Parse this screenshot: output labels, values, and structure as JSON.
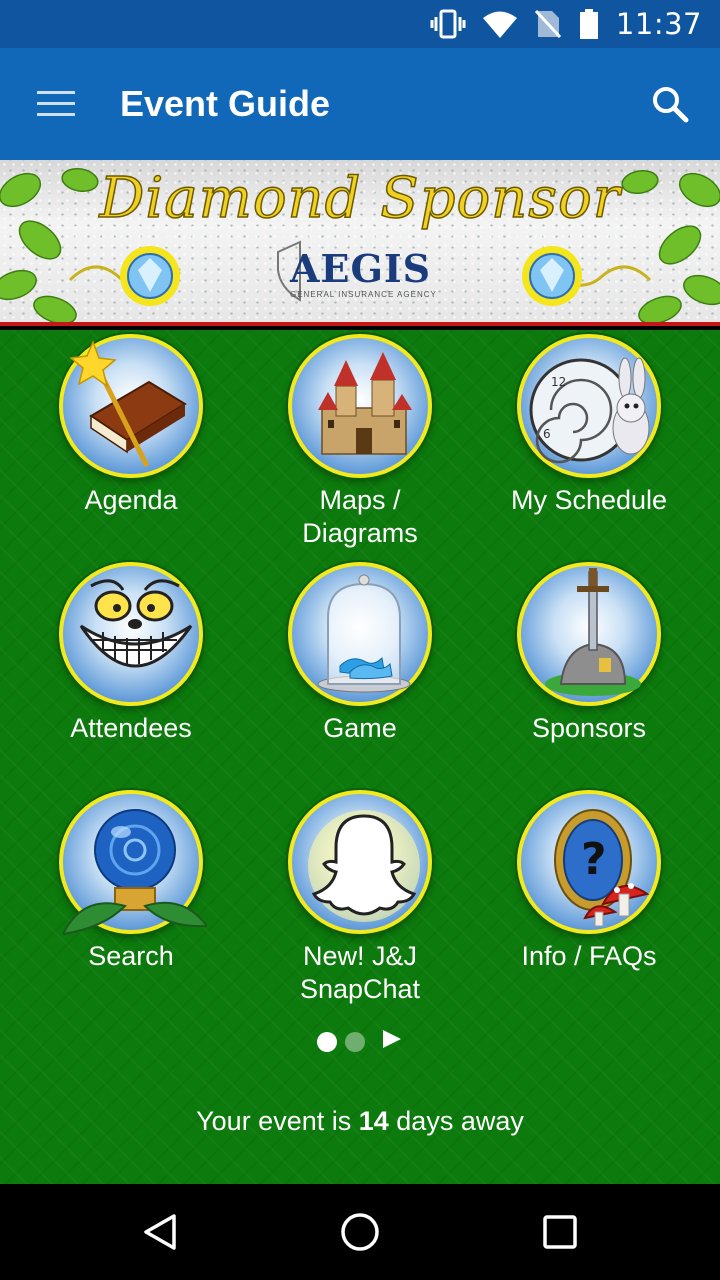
{
  "status_bar": {
    "time": "11:37",
    "icons": [
      "vibrate-icon",
      "wifi-icon",
      "no-sim-icon",
      "battery-icon"
    ]
  },
  "app_bar": {
    "title": "Event Guide",
    "menu_icon": "hamburger-menu-icon",
    "search_icon": "search-icon"
  },
  "banner": {
    "headline": "Diamond Sponsor",
    "sponsor_name": "AEGIS",
    "sponsor_tagline": "GENERAL INSURANCE AGENCY"
  },
  "tiles": [
    {
      "label": "Agenda",
      "icon": "magic-book-icon"
    },
    {
      "label": "Maps /\nDiagrams",
      "icon": "castle-icon"
    },
    {
      "label": "My Schedule",
      "icon": "clock-rabbit-icon"
    },
    {
      "label": "Attendees",
      "icon": "cheshire-cat-icon"
    },
    {
      "label": "Game",
      "icon": "glass-slipper-icon"
    },
    {
      "label": "Sponsors",
      "icon": "sword-in-stone-icon"
    },
    {
      "label": "Search",
      "icon": "crystal-ball-icon"
    },
    {
      "label": "New! J&J\nSnapChat",
      "icon": "snapchat-ghost-icon"
    },
    {
      "label": "Info / FAQs",
      "icon": "magic-mirror-icon"
    }
  ],
  "pager": {
    "pages": 2,
    "active_index": 0,
    "next_icon": "play-arrow-icon"
  },
  "countdown": {
    "prefix": "Your event is ",
    "days": "14",
    "suffix": " days away"
  },
  "nav_bar": {
    "back_icon": "back-triangle-icon",
    "home_icon": "home-circle-icon",
    "recents_icon": "recents-square-icon"
  },
  "colors": {
    "app_bar": "#1167b8",
    "status_bar": "#0f55a0",
    "background_green": "#0c7a0c",
    "tile_ring": "#f3ea1e"
  }
}
